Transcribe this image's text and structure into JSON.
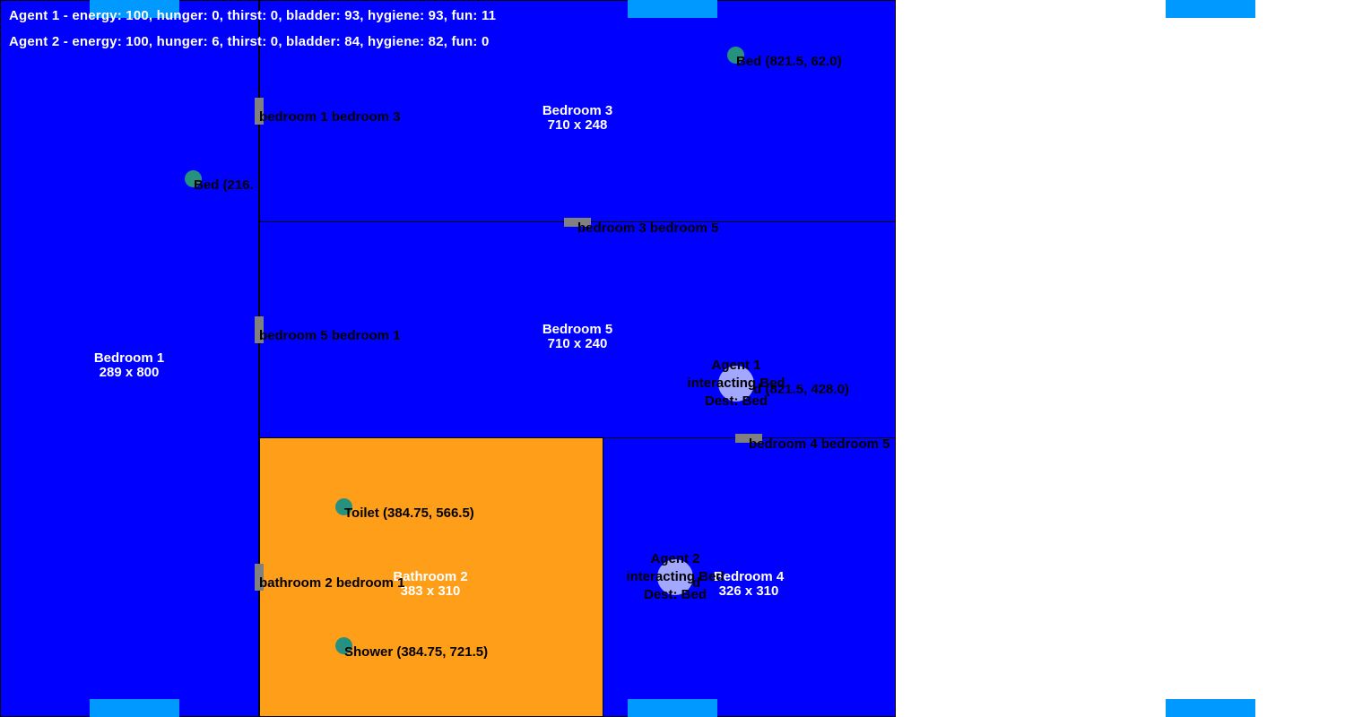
{
  "colors": {
    "bedroom": "#0000ff",
    "bathroom": "#ff9e18",
    "door": "#808080",
    "furniture": "#279180",
    "agent": "#a3a8ff",
    "window": "#0099ff"
  },
  "hud": {
    "agent1_status": "Agent 1 - energy: 100, hunger: 0, thirst: 0, bladder: 93, hygiene: 93, fun: 11",
    "agent2_status": "Agent 2 - energy: 100, hunger: 6, thirst: 0, bladder: 84, hygiene: 82, fun: 0"
  },
  "rooms": {
    "bedroom1": {
      "name": "Bedroom 1",
      "size": "289 x 800"
    },
    "bedroom3": {
      "name": "Bedroom 3",
      "size": "710 x 248"
    },
    "bedroom5": {
      "name": "Bedroom 5",
      "size": "710 x 240"
    },
    "bathroom2": {
      "name": "Bathroom 2",
      "size": "383 x 310"
    },
    "bedroom4": {
      "name": "Bedroom 4",
      "size": "326 x 310"
    }
  },
  "doors": {
    "b1_b3": "bedroom 1 bedroom 3",
    "b3_b5": "bedroom 3 bedroom 5",
    "b5_b1": "bedroom 5 bedroom 1",
    "b4_b5": "bedroom 4 bedroom 5",
    "ba2_b1": "bathroom 2 bedroom 1"
  },
  "objects": {
    "bed_b3": "Bed (821.5, 62.0)",
    "bed_b1": "Bed (216.",
    "bed_b5": "Bed (821.5, 428.0)",
    "bed_b4": "Bed",
    "toilet": "Toilet (384.75, 566.5)",
    "shower": "Shower (384.75, 721.5)"
  },
  "agents": {
    "agent1": {
      "name": "Agent 1",
      "state": "interacting Bed",
      "dest": "Dest: Bed"
    },
    "agent2": {
      "name": "Agent 2",
      "state": "interacting Bed",
      "dest": "Dest: Bed"
    }
  }
}
